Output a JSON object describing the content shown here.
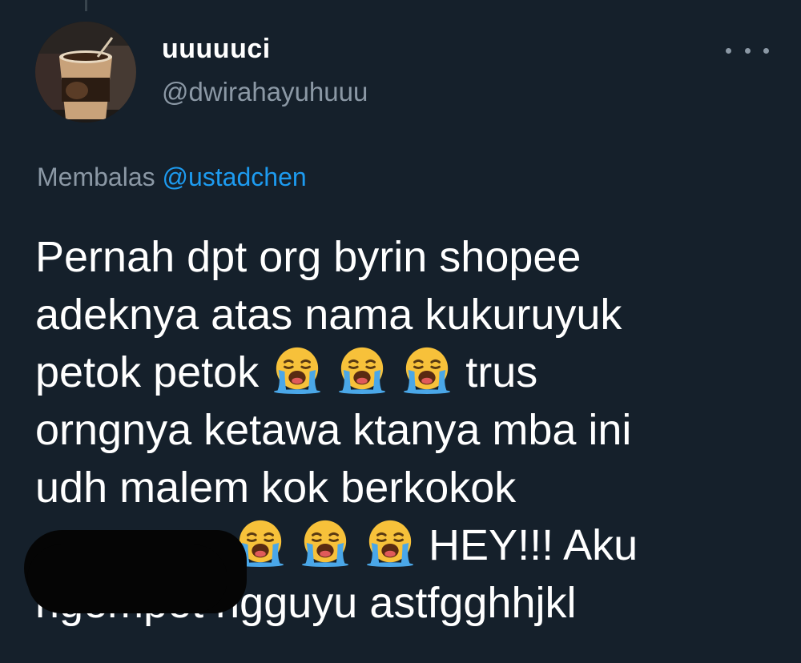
{
  "tweet": {
    "display_name": "uuuuuci",
    "handle": "@dwirahayuhuuu",
    "reply_prefix": "Membalas",
    "reply_mention": "@ustadchen",
    "avatar_icon": "coffee-cup-avatar",
    "more_icon": "more-dots-icon",
    "emoji_name": "loudly-crying-face",
    "body_lines": {
      "l1": "Pernah dpt org byrin shopee",
      "l2": "adeknya atas nama kukuruyuk",
      "l3_start": "petok petok",
      "l3_end": "trus",
      "l4": "orngnya ketawa ktanya mba ini",
      "l5": "udh malem kok berkokok",
      "l6_end": "HEY!!! Aku",
      "l7": "ngempet ngguyu astfgghhjkl"
    }
  },
  "colors": {
    "background": "#15202b",
    "primary_text": "#ffffff",
    "secondary_text": "#8b98a5",
    "link": "#1d9bf0",
    "redaction": "#050505"
  }
}
